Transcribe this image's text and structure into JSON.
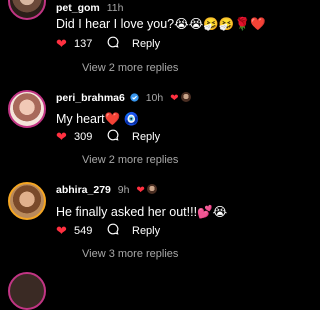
{
  "comments": [
    {
      "username": "pet_gom",
      "time": "11h",
      "text": "Did I hear I love you?😭😭🤧🤧🌹❤️",
      "likes": "137",
      "reply_label": "Reply",
      "more_replies": "View 2 more replies"
    },
    {
      "username": "peri_brahma6",
      "time": "10h",
      "verified": true,
      "creator_liked": true,
      "text": "My heart️❤️ 🧿",
      "likes": "309",
      "reply_label": "Reply",
      "more_replies": "View 2 more replies"
    },
    {
      "username": "abhira_279",
      "time": "9h",
      "creator_liked": true,
      "text": "He finally asked her out!!!💕😭",
      "likes": "549",
      "reply_label": "Reply",
      "more_replies": "View 3 more replies"
    }
  ],
  "icons": {
    "like": "heart-icon",
    "reply": "comment-bubble-icon",
    "verified": "verified-badge-icon"
  },
  "colors": {
    "background": "#000000",
    "like_red": "#ff3040",
    "secondary_text": "#a8a8a8"
  }
}
